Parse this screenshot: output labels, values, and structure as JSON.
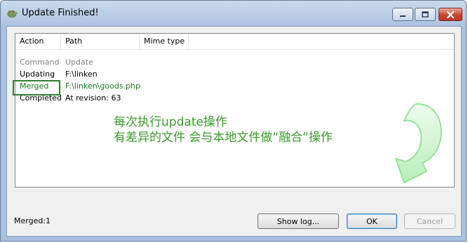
{
  "window": {
    "title": "Update Finished!",
    "controls": {
      "minimize": "minimize-icon",
      "maximize": "maximize-icon",
      "close": "close-icon"
    }
  },
  "table": {
    "columns": [
      "Action",
      "Path",
      "Mime type"
    ],
    "rows": [
      {
        "action": "Command",
        "path": "Update",
        "style": "muted"
      },
      {
        "action": "Updating",
        "path": "F:\\linken",
        "style": "normal"
      },
      {
        "action": "Merged",
        "path": "F:\\linken\\goods.php",
        "style": "merged"
      },
      {
        "action": "Completed",
        "path": "At revision: 63",
        "style": "normal"
      }
    ]
  },
  "annotation": {
    "line1": "每次执行update操作",
    "line2": "有差异的文件 会与本地文件做“融合”操作",
    "color": "#3a9a2a"
  },
  "status": {
    "text": "Merged:1"
  },
  "buttons": {
    "show_log": "Show log...",
    "ok": "OK",
    "cancel": "Cancel"
  },
  "colors": {
    "merged_text": "#1e7a1e",
    "highlight_box": "#2f7d2f",
    "arrow": "#b9eeb9"
  }
}
